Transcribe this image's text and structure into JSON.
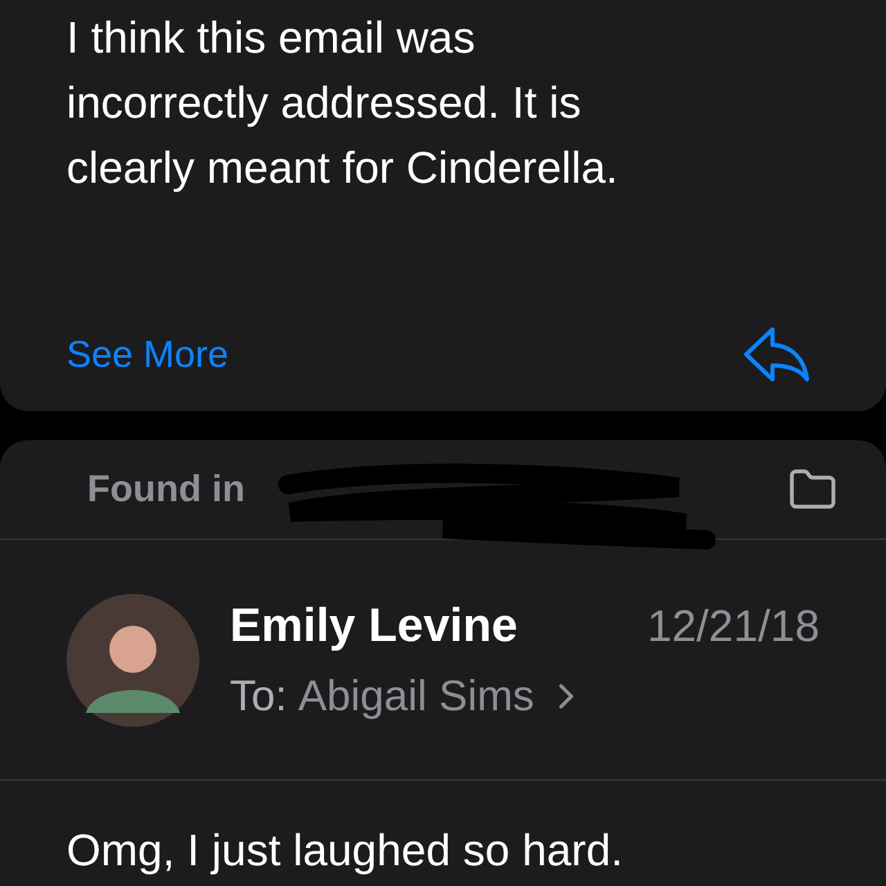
{
  "message_card": {
    "body_lines": [
      "I think this email was",
      "incorrectly addressed. It is",
      "clearly meant for Cinderella."
    ],
    "see_more": "See More"
  },
  "thread_card": {
    "found_in": "Found in",
    "redacted": true,
    "sender": {
      "name": "Emily Levine",
      "date": "12/21/18",
      "to_label": "To:",
      "recipient": "Abigail Sims"
    },
    "body": "Omg, I just laughed so hard."
  }
}
